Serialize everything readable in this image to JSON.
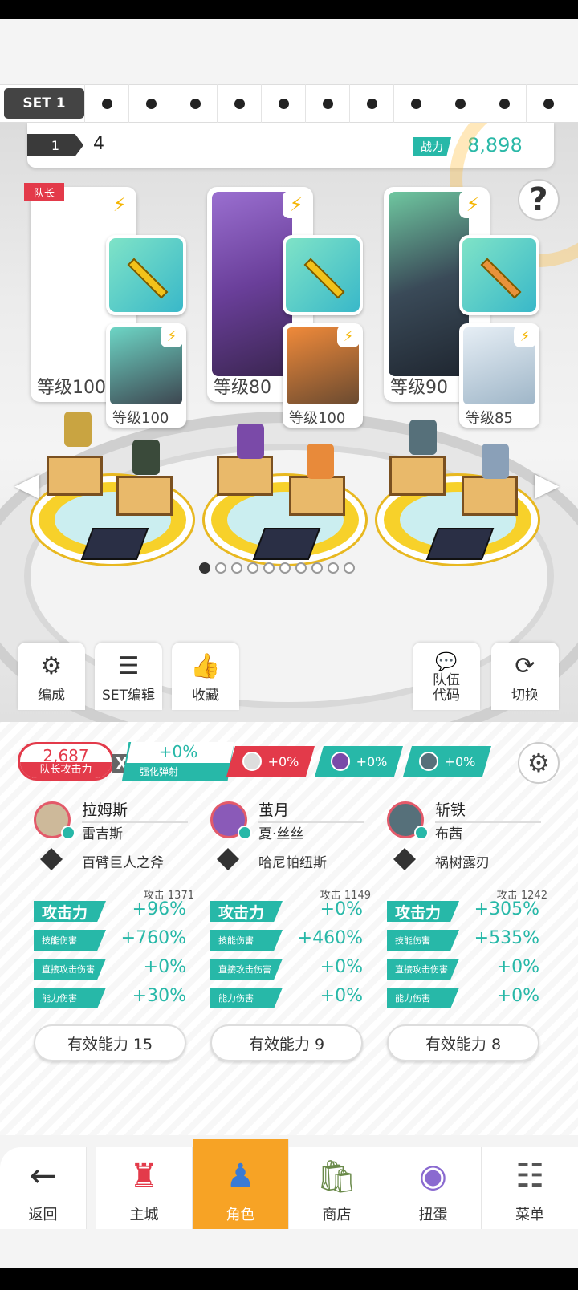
{
  "set_selector": {
    "active_label": "SET 1",
    "slot_count": 11
  },
  "team": {
    "number": "1",
    "name": "4",
    "power_label": "战力",
    "power_value": "8,898"
  },
  "help_icon": "?",
  "leader_tag": "队长",
  "slots": [
    {
      "main_level": "等级100",
      "sub_level": "等级100"
    },
    {
      "main_level": "等级80",
      "sub_level": "等级100"
    },
    {
      "main_level": "等级90",
      "sub_level": "等级85"
    }
  ],
  "page_dots": {
    "count": 10,
    "active": 0
  },
  "tools": {
    "formation": "编成",
    "set_edit": "SET编辑",
    "favorite": "收藏",
    "team_code": "队伍\n代码",
    "switch": "切换"
  },
  "summary": {
    "atk_value": "2,687",
    "atk_label": "队长攻击力",
    "x": "X",
    "boost_value": "+0%",
    "boost_label": "强化弹射",
    "mates": [
      "+0%",
      "+0%",
      "+0%"
    ]
  },
  "heroes": [
    {
      "name": "拉姆斯",
      "partner": "雷吉斯",
      "weapon": "百臂巨人之斧",
      "atk_ref": "攻击 1371",
      "stats": [
        {
          "label": "攻击力",
          "value": "+96%"
        },
        {
          "label": "技能伤害",
          "value": "+760%"
        },
        {
          "label": "直接攻击伤害",
          "value": "+0%"
        },
        {
          "label": "能力伤害",
          "value": "+30%"
        }
      ],
      "effective": "有效能力 15"
    },
    {
      "name": "茧月",
      "partner": "夏·丝丝",
      "weapon": "哈尼帕纽斯",
      "atk_ref": "攻击 1149",
      "stats": [
        {
          "label": "攻击力",
          "value": "+0%"
        },
        {
          "label": "技能伤害",
          "value": "+460%"
        },
        {
          "label": "直接攻击伤害",
          "value": "+0%"
        },
        {
          "label": "能力伤害",
          "value": "+0%"
        }
      ],
      "effective": "有效能力 9"
    },
    {
      "name": "斩铁",
      "partner": "布茜",
      "weapon": "祸树露刃",
      "atk_ref": "攻击 1242",
      "stats": [
        {
          "label": "攻击力",
          "value": "+305%"
        },
        {
          "label": "技能伤害",
          "value": "+535%"
        },
        {
          "label": "直接攻击伤害",
          "value": "+0%"
        },
        {
          "label": "能力伤害",
          "value": "+0%"
        }
      ],
      "effective": "有效能力 8"
    }
  ],
  "nav": {
    "back": "返回",
    "main_city": "主城",
    "character": "角色",
    "shop": "商店",
    "gacha": "扭蛋",
    "menu": "菜单"
  },
  "colors": {
    "teal": "#27b8a8",
    "red": "#e33a4a",
    "orange_active": "#f7a325"
  }
}
